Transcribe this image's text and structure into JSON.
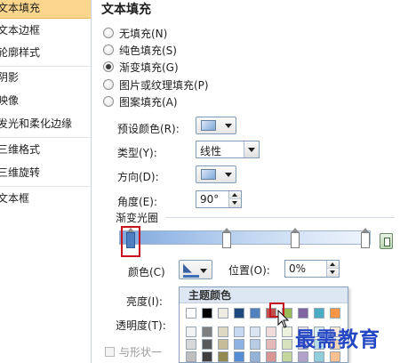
{
  "sidebar": {
    "items": [
      {
        "label": "文本填充",
        "selected": true
      },
      {
        "label": "文本边框",
        "selected": false
      },
      {
        "label": "轮廓样式",
        "selected": false
      },
      {
        "label": "阴影",
        "selected": false
      },
      {
        "label": "映像",
        "selected": false
      },
      {
        "label": "发光和柔化边缘",
        "selected": false
      },
      {
        "label": "三维格式",
        "selected": false
      },
      {
        "label": "三维旋转",
        "selected": false
      },
      {
        "label": "文本框",
        "selected": false
      }
    ]
  },
  "main": {
    "title": "文本填充",
    "fill_options": [
      {
        "label": "无填充(N)",
        "checked": false
      },
      {
        "label": "纯色填充(S)",
        "checked": false
      },
      {
        "label": "渐变填充(G)",
        "checked": true
      },
      {
        "label": "图片或纹理填充(P)",
        "checked": false
      },
      {
        "label": "图案填充(A)",
        "checked": false
      }
    ],
    "preset_color_label": "预设颜色(R):",
    "type_label": "类型(Y):",
    "type_value": "线性",
    "direction_label": "方向(D):",
    "angle_label": "角度(E):",
    "angle_value": "90°",
    "gradient_stops_label": "渐变光圈",
    "color_label": "颜色(C)",
    "position_label": "位置(O):",
    "position_value": "0%",
    "brightness_label": "亮度(I):",
    "transparency_label": "透明度(T):",
    "rotate_with_shape_label": "与形状一"
  },
  "color_popup": {
    "header": "主题颜色",
    "theme_row": [
      "#ffffff",
      "#000000",
      "#eeece1",
      "#1f497d",
      "#4f81bd",
      "#c0504d",
      "#9bbb59",
      "#8064a2",
      "#4bacc6",
      "#f79646"
    ],
    "shade_row_1": [
      "#f2f2f2",
      "#7f7f7f",
      "#ddd9c3",
      "#c6d9f0",
      "#dbe5f1",
      "#f2dcdb",
      "#ebf1dd",
      "#e5e0ec",
      "#dbeef3",
      "#fdeada"
    ],
    "shade_row_2": [
      "#d8d8d8",
      "#595959",
      "#c4bd97",
      "#8db3e2",
      "#b8cce4",
      "#e5b9b7",
      "#d7e3bc",
      "#ccc1d9",
      "#b7dde8",
      "#fbd5b5"
    ],
    "shade_row_3": [
      "#bfbfbf",
      "#3f3f3f",
      "#938953",
      "#548dd4",
      "#95b3d7",
      "#d99694",
      "#c3d69b",
      "#b2a2c7",
      "#92cddc",
      "#fac08f"
    ]
  },
  "accent_colors": {
    "selection": "#fbd68c",
    "highlight": "#c8141c",
    "watermark": "#2447c4"
  },
  "watermark": "最需教育"
}
